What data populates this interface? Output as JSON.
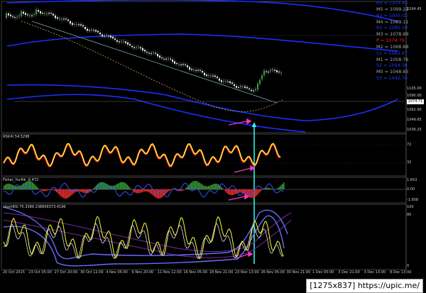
{
  "legend": [
    {
      "label": "R5 = 1103.43",
      "color": "#1e3cff"
    },
    {
      "label": "M5 = 1099.22",
      "color": "#aaaaaa"
    },
    {
      "label": "R2 = 1095.02",
      "color": "#1e3cff"
    },
    {
      "label": "M4 = 1089.11",
      "color": "#aaaaaa"
    },
    {
      "label": "R1 = 1082.20",
      "color": "#1e3cff"
    },
    {
      "label": "M3 = 1078.99",
      "color": "#aaaaaa"
    },
    {
      "label": "P = 1074.79",
      "color": "#ff2020"
    },
    {
      "label": "M2 = 1068.88",
      "color": "#aaaaaa"
    },
    {
      "label": "S1 = 1062.97",
      "color": "#1e3cff"
    },
    {
      "label": "M1 = 1058.76",
      "color": "#aaaaaa"
    },
    {
      "label": "S2 = 1054.56",
      "color": "#1e3cff"
    },
    {
      "label": "M0 = 1048.65",
      "color": "#aaaaaa"
    },
    {
      "label": "S3 = 1042.74",
      "color": "#1e3cff"
    }
  ],
  "panes": {
    "rsi_label": "RSI(4) 54.5298",
    "fisher_label": "Fisher_Yur4ik -0.472",
    "stoch_label": "stochRSI 75.3389 238609373.4196"
  },
  "price_axis": [
    "1164.45",
    "1105.00",
    "1090.00",
    "1075.71",
    "1062.90",
    "1049.65",
    "1036.25"
  ],
  "current_price": "1074.71",
  "rsi_axis": [
    "72",
    "32"
  ],
  "fisher_axis": [
    "1.653",
    "0.00",
    "-1.658"
  ],
  "stoch_axis": [
    "100",
    "80",
    "0"
  ],
  "time_axis": [
    "20 Oct 2015",
    "23 Oct 05:00",
    "27 Oct 20:00",
    "30 Oct 12:00",
    "4 Nov 05:00",
    "6 Nov 20:00",
    "11 Nov 12:00",
    "16 Nov 05:00",
    "18 Nov 21:00",
    "23 Nov 13:00",
    "26 Nov 05:00",
    "30 Nov 21:00",
    "1 Dec 05:00",
    "3 Dec 21:00",
    "3 Dec 13:00",
    "8 Dec 13:00"
  ],
  "footer": "[1275x837] https://upic.me/",
  "colors": {
    "bg": "#000000",
    "band": "#1a2fff",
    "bull": "#3aa53a",
    "bear": "#ff3030",
    "cyan": "#33ffff",
    "magenta": "#ff33cc"
  }
}
